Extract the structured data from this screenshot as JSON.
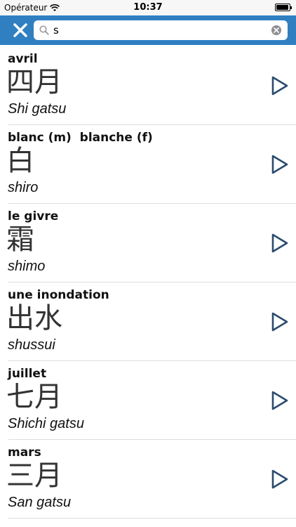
{
  "status": {
    "carrier": "Opérateur",
    "time": "10:37",
    "battery_level": 0.95
  },
  "search": {
    "value": "s",
    "placeholder": ""
  },
  "colors": {
    "accent": "#2f7fc1",
    "play_icon": "#2b4b6f"
  },
  "entries": [
    {
      "french": "avril",
      "kanji": "四月",
      "romaji": "Shi gatsu"
    },
    {
      "french": "blanc (m)  blanche (f)",
      "kanji": "白",
      "romaji": "shiro"
    },
    {
      "french": "le givre",
      "kanji": "霜",
      "romaji": "shimo"
    },
    {
      "french": "une inondation",
      "kanji": "出水",
      "romaji": "shussui"
    },
    {
      "french": "juillet",
      "kanji": "七月",
      "romaji": "Shichi gatsu"
    },
    {
      "french": "mars",
      "kanji": "三月",
      "romaji": "San gatsu"
    }
  ]
}
